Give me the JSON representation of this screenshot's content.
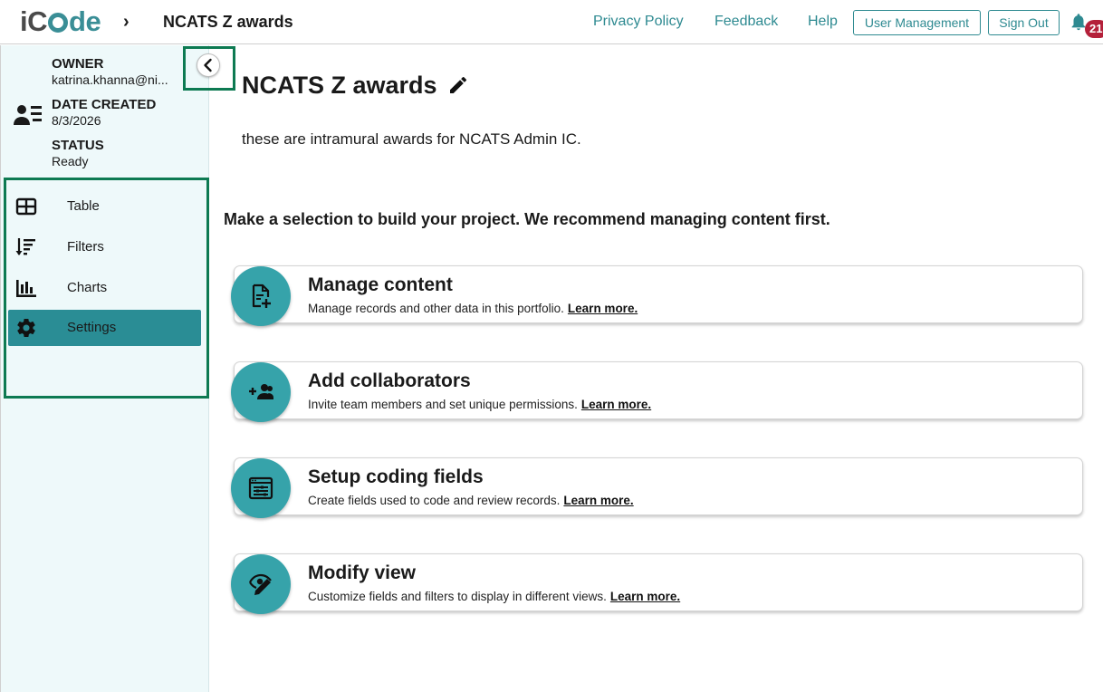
{
  "header": {
    "logo_prefix": "i",
    "logo_suffix": "de",
    "breadcrumb_separator": "›",
    "project_title": "NCATS Z awards",
    "nav": {
      "privacy": "Privacy Policy",
      "feedback": "Feedback",
      "help": "Help",
      "user_management": "User Management",
      "sign_out": "Sign Out"
    },
    "notification_count": "21"
  },
  "sidebar": {
    "owner_label": "OWNER",
    "owner_value": "katrina.khanna@ni...",
    "date_label": "DATE CREATED",
    "date_value": "8/3/2026",
    "status_label": "STATUS",
    "status_value": "Ready",
    "menu": [
      {
        "label": "Table",
        "icon": "table-icon"
      },
      {
        "label": "Filters",
        "icon": "filter-sort-icon"
      },
      {
        "label": "Charts",
        "icon": "bar-chart-icon"
      },
      {
        "label": "Settings",
        "icon": "gear-icon",
        "active": true
      }
    ]
  },
  "main": {
    "title": "NCATS Z awards",
    "description": "these are intramural awards for NCATS Admin IC.",
    "prompt": "Make a selection to build your project. We recommend managing content first.",
    "cards": [
      {
        "title": "Manage content",
        "desc": "Manage records and other data in this portfolio.",
        "link": "Learn more.",
        "icon": "add-document-icon"
      },
      {
        "title": "Add collaborators",
        "desc": "Invite team members and set unique permissions.",
        "link": "Learn more.",
        "icon": "add-group-icon"
      },
      {
        "title": "Setup coding fields",
        "desc": "Create fields used to code and review records.",
        "link": "Learn more.",
        "icon": "form-fields-icon"
      },
      {
        "title": "Modify view",
        "desc": "Customize fields and filters to display in different views.",
        "link": "Learn more.",
        "icon": "eye-pencil-icon"
      }
    ]
  },
  "colors": {
    "brand": "#2e8a91",
    "accent_circle": "#36a3aa",
    "sidebar_bg": "#eef9fa",
    "active_item": "#2a8d95",
    "highlight_frame": "#0d7a52",
    "badge": "#b4203a"
  }
}
